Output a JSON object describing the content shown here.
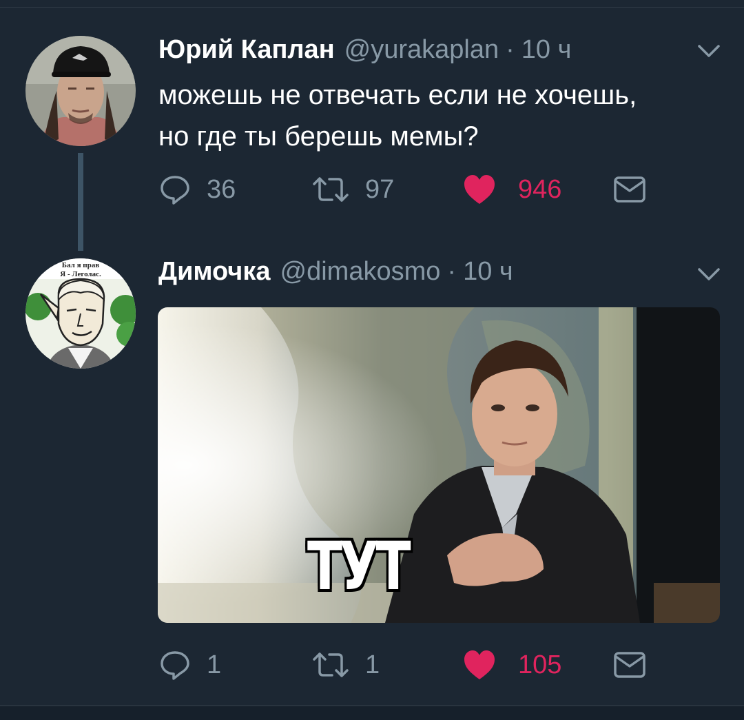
{
  "theme": {
    "background": "#1c2733",
    "secondary_text": "#8899a6",
    "like_color": "#e0245e",
    "thread_line": "#3d5466"
  },
  "tweets": [
    {
      "name": "Юрий Каплан",
      "handle": "@yurakaplan",
      "separator": "·",
      "time": "10 ч",
      "text_lines": [
        "можешь не отвечать если не хочешь,",
        "но где ты берешь мемы?"
      ],
      "actions": {
        "reply_count": "36",
        "retweet_count": "97",
        "like_count": "946",
        "liked": true
      },
      "icons": [
        "reply-icon",
        "retweet-icon",
        "heart-icon",
        "message-icon",
        "chevron-down-icon"
      ]
    },
    {
      "name": "Димочка",
      "handle": "@dimakosmo",
      "separator": "·",
      "time": "10 ч",
      "avatar_text": [
        "Бал я прав",
        "Я - Леголас."
      ],
      "media": {
        "caption": "ТУТ"
      },
      "actions": {
        "reply_count": "1",
        "retweet_count": "1",
        "like_count": "105",
        "liked": true
      },
      "icons": [
        "reply-icon",
        "retweet-icon",
        "heart-icon",
        "message-icon",
        "chevron-down-icon"
      ]
    }
  ]
}
